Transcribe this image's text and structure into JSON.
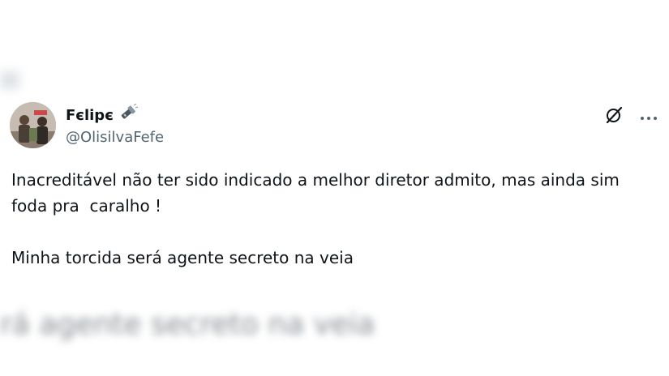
{
  "author": {
    "display_name": "Fєlipє",
    "handle": "@OlisilvaFefe",
    "name_emoji_icon": "flashlight-icon"
  },
  "tweet": {
    "text": "Inacreditável não ter sido indicado a melhor diretor admito, mas ainda sim foda pra  caralho !\n\nMinha torcida será agente secreto na veia"
  },
  "icons": {
    "grok": "grok-icon",
    "more": "more-icon"
  },
  "blurred_quote": {
    "text": "rá agente secreto na veia"
  }
}
